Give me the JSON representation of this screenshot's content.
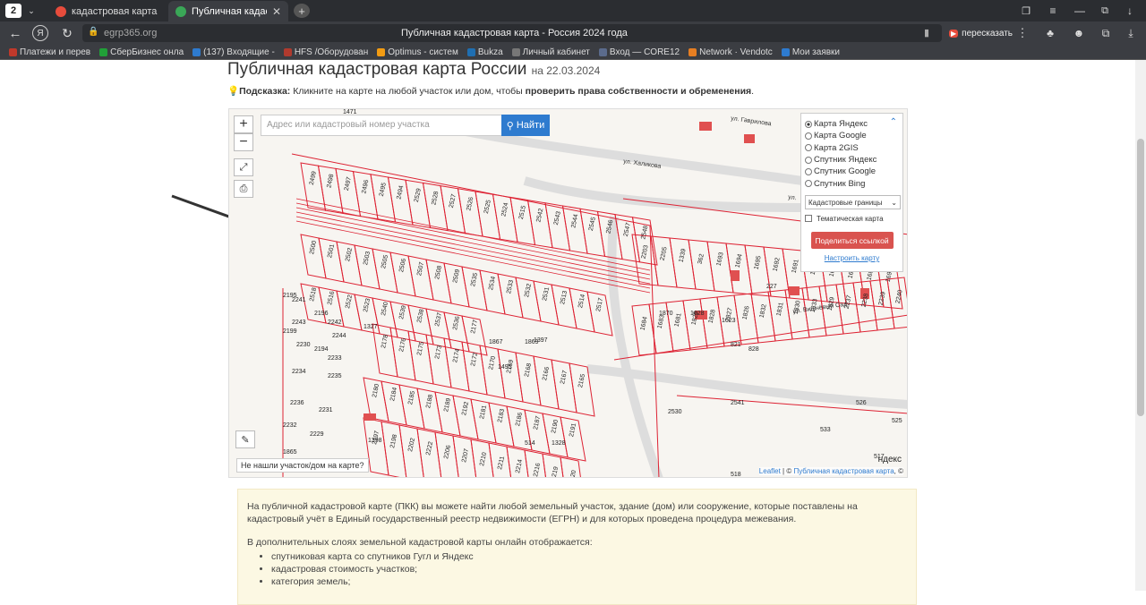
{
  "browser": {
    "tab_count": "2",
    "tabs": [
      {
        "label": "кадастровая карта публи",
        "active": false,
        "color": "#e74c3c"
      },
      {
        "label": "Публичная кадастровая",
        "active": true,
        "color": "#3aa757"
      }
    ],
    "url": "egrp365.org",
    "page_title": "Публичная кадастровая карта - Россия 2024 года",
    "retell_label": "пересказать",
    "bookmarks": [
      {
        "label": "Платежи и перев",
        "color": "#c0392b"
      },
      {
        "label": "СберБизнес онла",
        "color": "#21a038"
      },
      {
        "label": "(137) Входящие -",
        "color": "#2e7bcf"
      },
      {
        "label": "HFS /Оборудован",
        "color": "#b03a2e"
      },
      {
        "label": "Optimus - систем",
        "color": "#f39c12"
      },
      {
        "label": "Bukza",
        "color": "#1f6fb2"
      },
      {
        "label": "Личный кабинет",
        "color": "#777777"
      },
      {
        "label": "Вход — CORE12",
        "color": "#5b6b8c"
      },
      {
        "label": "Network · Vendotc",
        "color": "#e67e22"
      },
      {
        "label": "Мои заявки",
        "color": "#2e7bcf"
      }
    ]
  },
  "page": {
    "title": "Публичная кадастровая карта России",
    "date": "на 22.03.2024",
    "hint_label": "Подсказка:",
    "hint_text": " Кликните на карте на любой участок или дом, чтобы ",
    "hint_bold": "проверить права собственности и обременения",
    "hint_end": "."
  },
  "map": {
    "search_placeholder": "Адрес или кадастровый номер участка",
    "find_label": "Найти",
    "zoom_in": "+",
    "zoom_out": "−",
    "layers": [
      "Карта Яндекс",
      "Карта Google",
      "Карта 2GIS",
      "Спутник Яндекс",
      "Спутник Google",
      "Спутник Bing"
    ],
    "selected_layer": 0,
    "overlay_select": "Кадастровые границы",
    "thematic_label": "Тематическая карта",
    "share_label": "Поделиться ссылкой",
    "settings_label": "Настроить карту",
    "not_found": "Не нашли участок/дом на карте?",
    "attribution_leaflet": "Leaflet",
    "attribution_sep": " | © ",
    "attribution_pkk": "Публичная кадастровая карта",
    "attribution_end": ", ©",
    "yandex_logo": "ндекс",
    "streets": [
      "ул. Гаврилова",
      "ул. Халикова",
      "ул. Вишнёвый Сад",
      "ул."
    ],
    "parcels": [
      "2499",
      "2498",
      "2497",
      "2496",
      "2495",
      "2494",
      "2529",
      "2528",
      "2527",
      "2526",
      "2525",
      "2524",
      "2515",
      "2542",
      "2543",
      "2544",
      "2545",
      "2546",
      "2547",
      "2548",
      "2500",
      "2501",
      "2502",
      "2503",
      "2505",
      "2506",
      "2507",
      "2508",
      "2509",
      "2535",
      "2534",
      "2533",
      "2532",
      "2531",
      "2513",
      "2514",
      "2517",
      "2518",
      "2516",
      "2522",
      "2523",
      "2540",
      "2539",
      "2538",
      "2537",
      "2536",
      "2177",
      "2178",
      "2176",
      "2175",
      "2173",
      "2174",
      "2172",
      "2170",
      "2169",
      "2168",
      "2166",
      "2167",
      "2165",
      "2180",
      "2184",
      "2185",
      "2188",
      "2189",
      "2192",
      "2181",
      "2183",
      "2186",
      "2187",
      "2190",
      "2191",
      "2195",
      "2196",
      "2199",
      "2194",
      "2197",
      "2198",
      "2202",
      "2222",
      "2206",
      "2207",
      "2210",
      "2211",
      "2214",
      "2216",
      "2219",
      "2220",
      "2203",
      "2205",
      "1339",
      "362",
      "1693",
      "1694",
      "1695",
      "1692",
      "1691",
      "1689",
      "1688",
      "1687",
      "1686",
      "1690",
      "1684",
      "1683",
      "1681",
      "1825",
      "1828",
      "1827",
      "1826",
      "1832",
      "1831",
      "1830",
      "1833",
      "1829",
      "2237",
      "2238",
      "2239",
      "2240",
      "2241",
      "2242",
      "2243",
      "2244",
      "2230",
      "2233",
      "2234",
      "2235",
      "2236",
      "2231",
      "2232",
      "2229",
      "1865",
      "1867",
      "1869",
      "1870",
      "1628",
      "1623",
      "821",
      "828",
      "227",
      "2541",
      "2530",
      "533",
      "526",
      "525",
      "517",
      "518",
      "514",
      "1328",
      "1327",
      "1398",
      "1397",
      "1495",
      "1494",
      "454",
      "470",
      "1471",
      "464"
    ]
  },
  "info": {
    "p1": "На публичной кадастровой карте (ПКК) вы можете найти любой земельный участок, здание (дом) или сооружение, которые поставлены на кадастровый учёт в Единый государственный реестр недвижимости (ЕГРН) и для которых проведена процедура межевания.",
    "p2": "В дополнительных слоях земельной кадастровой карты онлайн отображается:",
    "items": [
      "спутниковая карта со спутников Гугл и Яндекс",
      "кадастровая стоимость участков;",
      "категория земель;"
    ]
  }
}
